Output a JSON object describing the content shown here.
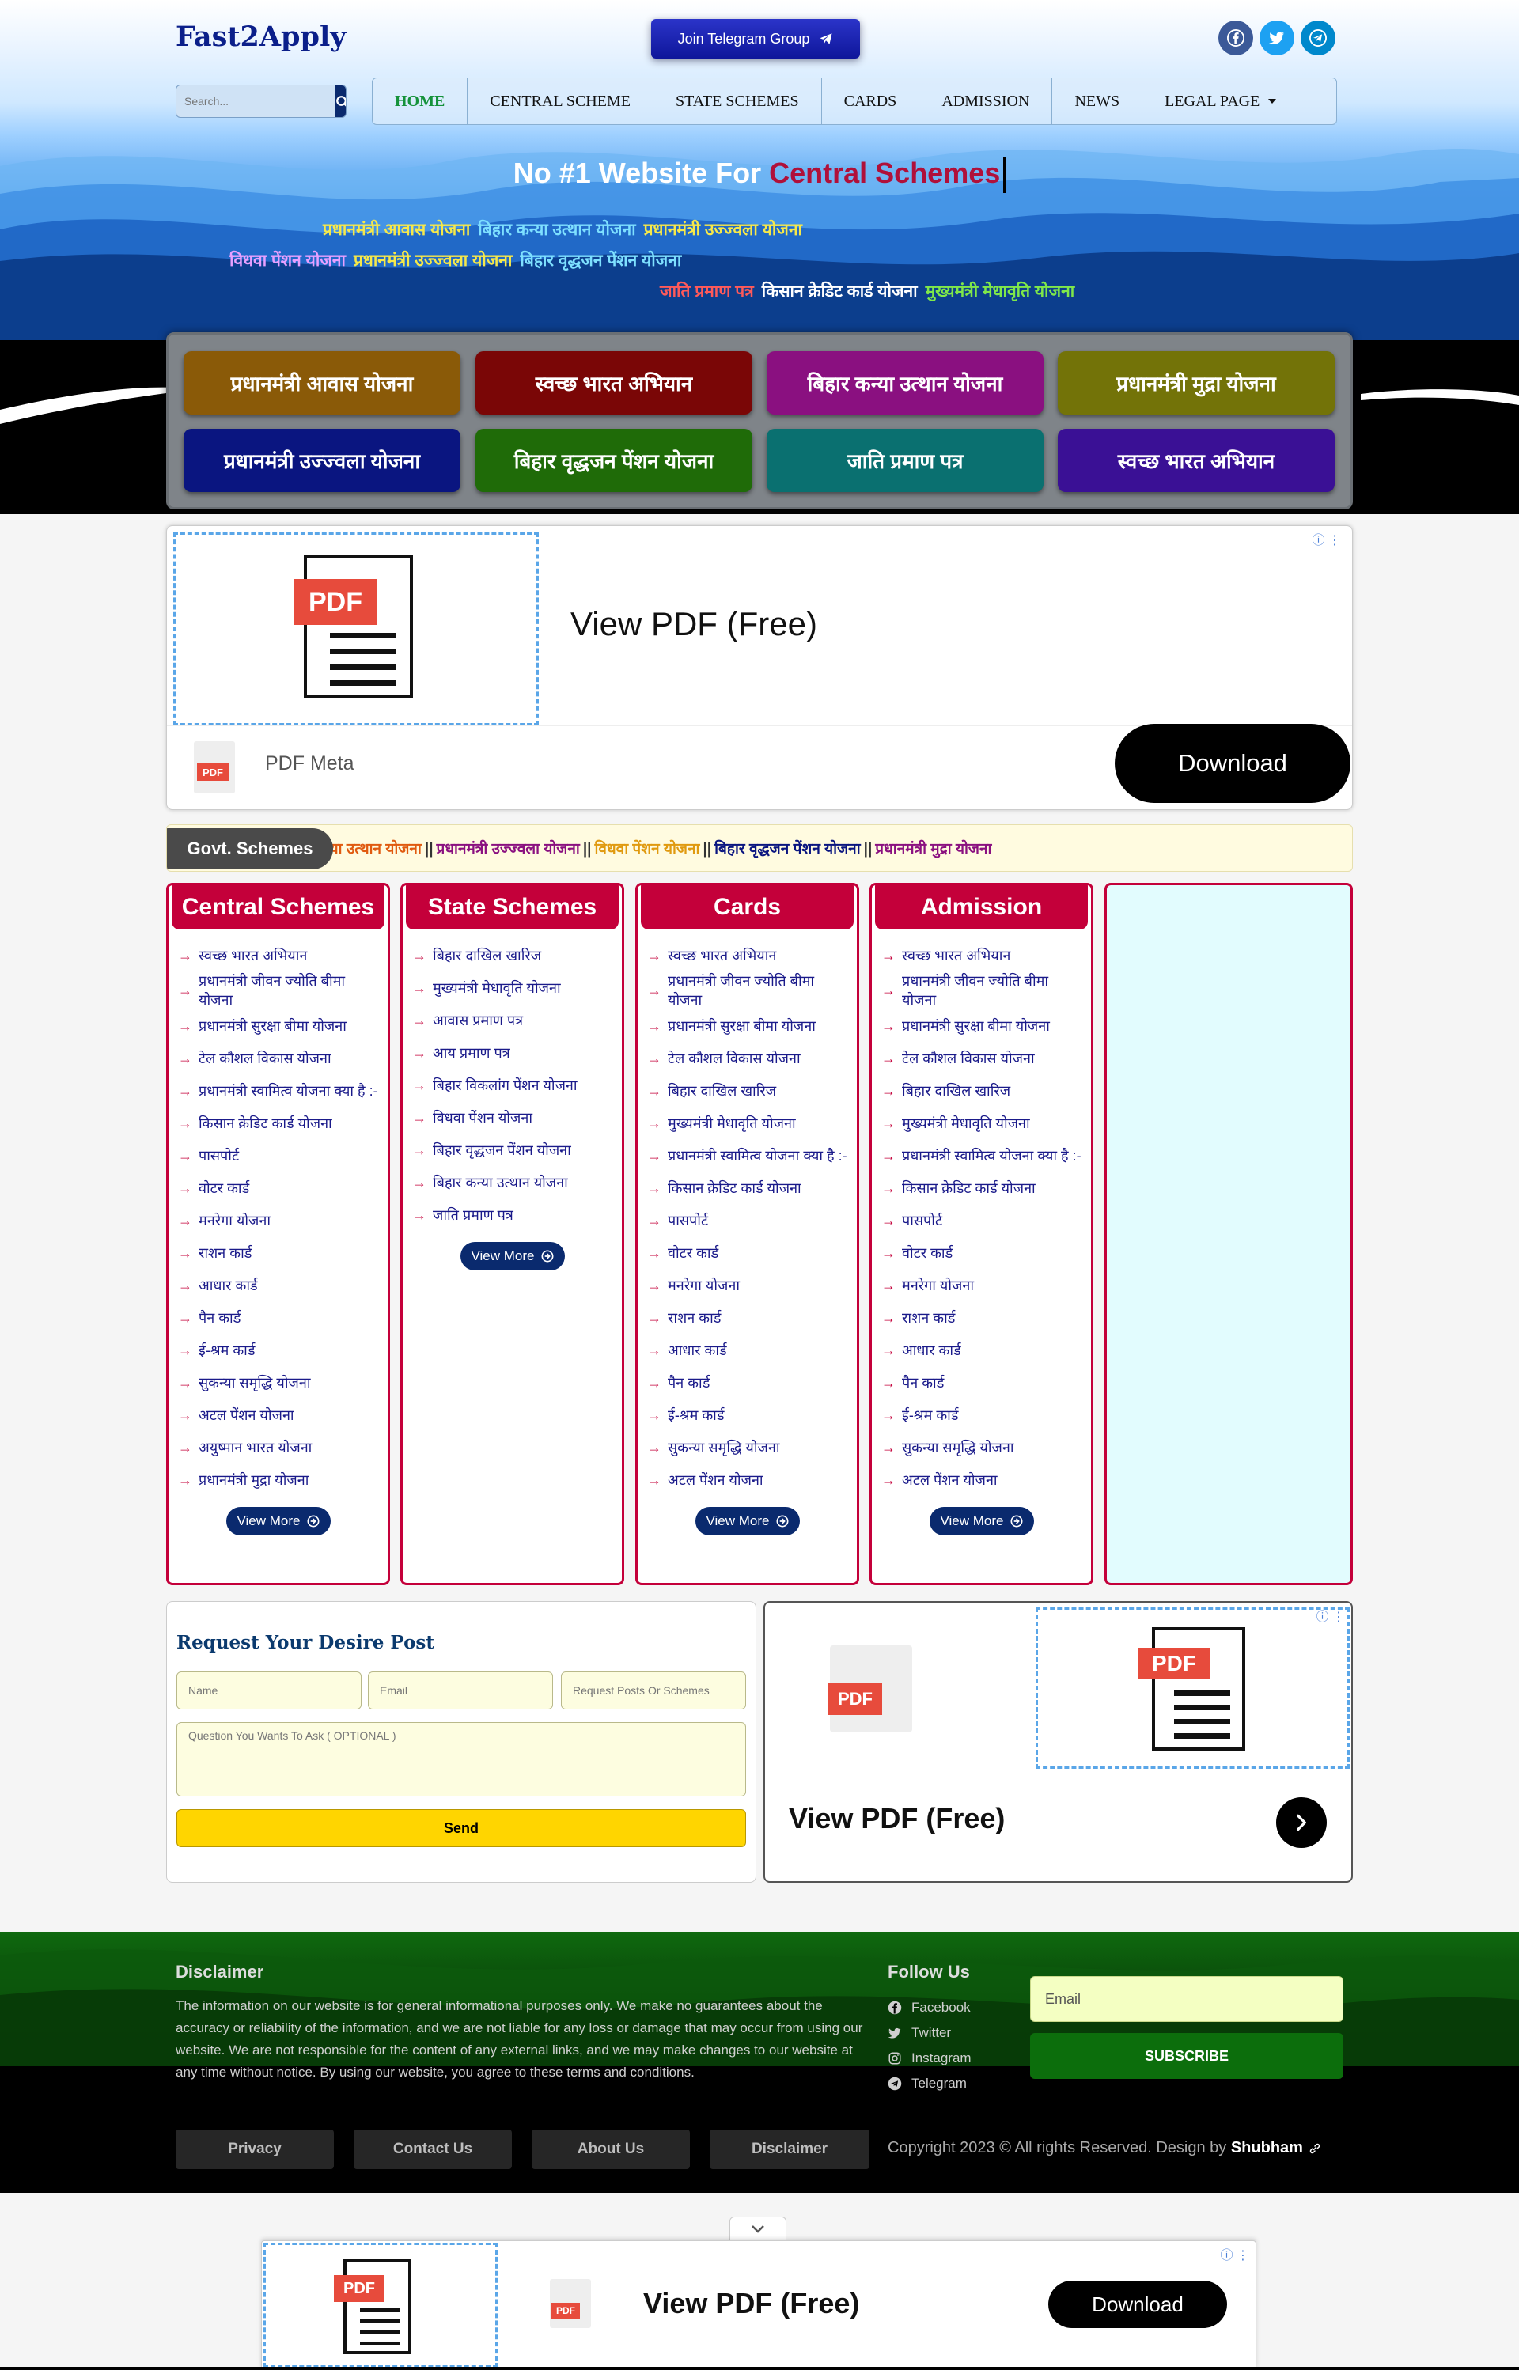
{
  "header": {
    "logo": "Fast2Apply",
    "telegram_button": "Join Telegram Group",
    "social": [
      {
        "name": "facebook",
        "icon": "facebook-icon",
        "color": "#3b5998"
      },
      {
        "name": "twitter",
        "icon": "twitter-icon",
        "color": "#1da1f2"
      },
      {
        "name": "telegram",
        "icon": "telegram-icon",
        "color": "#0088cc"
      }
    ],
    "search_placeholder": "Search...",
    "nav": [
      "HOME",
      "CENTRAL SCHEME",
      "STATE SCHEMES",
      "CARDS",
      "ADMISSION",
      "NEWS",
      "LEGAL PAGE"
    ],
    "active_nav": "HOME"
  },
  "hero": {
    "headline_prefix": "No #1 Website For ",
    "headline_highlight": "Central Schemes",
    "rows": [
      [
        {
          "t": "प्रधानमंत्री आवास योजना",
          "c": "#f6e84a"
        },
        {
          "t": "बिहार कन्या उत्थान योजना",
          "c": "#7ee0ff"
        },
        {
          "t": "प्रधानमंत्री उज्ज्वला योजना",
          "c": "#f6e84a"
        }
      ],
      [
        {
          "t": "विधवा पेंशन योजना",
          "c": "#e8a0ff"
        },
        {
          "t": "प्रधानमंत्री उज्ज्वला योजना",
          "c": "#f6e84a"
        },
        {
          "t": "बिहार वृद्धजन पेंशन योजना",
          "c": "#7ee0ff"
        }
      ],
      [
        {
          "t": "जाति प्रमाण पत्र",
          "c": "#ff5a5a"
        },
        {
          "t": "किसान क्रेडिट कार्ड योजना",
          "c": "#ffffff"
        },
        {
          "t": "मुख्यमंत्री मेधावृति योजना",
          "c": "#7fe84a"
        }
      ]
    ]
  },
  "scheme_buttons": [
    {
      "label": "प्रधानमंत्री आवास योजना",
      "color": "#8a5a08"
    },
    {
      "label": "स्वच्छ भारत अभियान",
      "color": "#7a0606"
    },
    {
      "label": "बिहार कन्या उत्थान योजना",
      "color": "#8a1080"
    },
    {
      "label": "प्रधानमंत्री मुद्रा योजना",
      "color": "#737308"
    },
    {
      "label": "प्रधानमंत्री उज्ज्वला योजना",
      "color": "#0a1580"
    },
    {
      "label": "बिहार वृद्धजन पेंशन योजना",
      "color": "#1f6b08"
    },
    {
      "label": "जाति प्रमाण पत्र",
      "color": "#0a7070"
    },
    {
      "label": "स्वच्छ भारत अभियान",
      "color": "#3a1095"
    }
  ],
  "ad_top": {
    "title": "View PDF (Free)",
    "brand": "PDF Meta",
    "cta": "Download",
    "pdf_label": "PDF"
  },
  "ticker": {
    "label": "Govt. Schemes",
    "items": [
      {
        "t": "न्या उत्थान योजना",
        "c": "#e05a10"
      },
      {
        "t": "प्रधानमंत्री उज्ज्वला योजना",
        "c": "#8a1080"
      },
      {
        "t": "विधवा पेंशन योजना",
        "c": "#e09a10"
      },
      {
        "t": "बिहार वृद्धजन पेंशन योजना",
        "c": "#0a1580"
      },
      {
        "t": "प्रधानमंत्री मुद्रा योजना",
        "c": "#8a1080"
      }
    ],
    "sep": "||"
  },
  "columns": [
    {
      "title": "Central Schemes",
      "items": [
        "स्वच्छ भारत अभियान",
        "प्रधानमंत्री जीवन ज्योति बीमा योजना",
        "प्रधानमंत्री सुरक्षा बीमा योजना",
        "टेल कौशल विकास योजना",
        "प्रधानमंत्री स्वामित्व योजना क्या है :-",
        "किसान क्रेडिट कार्ड योजना",
        "पासपोर्ट",
        "वोटर कार्ड",
        "मनरेगा योजना",
        "राशन कार्ड",
        "आधार कार्ड",
        "पैन कार्ड",
        "ई-श्रम कार्ड",
        "सुकन्या समृद्धि योजना",
        "अटल पेंशन योजना",
        "अयुष्मान भारत योजना",
        "प्रधानमंत्री मुद्रा योजना"
      ]
    },
    {
      "title": "State Schemes",
      "items": [
        "बिहार दाखिल खारिज",
        "मुख्यमंत्री मेधावृति योजना",
        "आवास प्रमाण पत्र",
        "आय प्रमाण पत्र",
        "बिहार विकलांग पेंशन योजना",
        "विधवा पेंशन योजना",
        "बिहार वृद्धजन पेंशन योजना",
        "बिहार कन्या उत्थान योजना",
        "जाति प्रमाण पत्र"
      ]
    },
    {
      "title": "Cards",
      "items": [
        "स्वच्छ भारत अभियान",
        "प्रधानमंत्री जीवन ज्योति बीमा योजना",
        "प्रधानमंत्री सुरक्षा बीमा योजना",
        "टेल कौशल विकास योजना",
        "बिहार दाखिल खारिज",
        "मुख्यमंत्री मेधावृति योजना",
        "प्रधानमंत्री स्वामित्व योजना क्या है :-",
        "किसान क्रेडिट कार्ड योजना",
        "पासपोर्ट",
        "वोटर कार्ड",
        "मनरेगा योजना",
        "राशन कार्ड",
        "आधार कार्ड",
        "पैन कार्ड",
        "ई-श्रम कार्ड",
        "सुकन्या समृद्धि योजना",
        "अटल पेंशन योजना"
      ]
    },
    {
      "title": "Admission",
      "items": [
        "स्वच्छ भारत अभियान",
        "प्रधानमंत्री जीवन ज्योति बीमा योजना",
        "प्रधानमंत्री सुरक्षा बीमा योजना",
        "टेल कौशल विकास योजना",
        "बिहार दाखिल खारिज",
        "मुख्यमंत्री मेधावृति योजना",
        "प्रधानमंत्री स्वामित्व योजना क्या है :-",
        "किसान क्रेडिट कार्ड योजना",
        "पासपोर्ट",
        "वोटर कार्ड",
        "मनरेगा योजना",
        "राशन कार्ड",
        "आधार कार्ड",
        "पैन कार्ड",
        "ई-श्रम कार्ड",
        "सुकन्या समृद्धि योजना",
        "अटल पेंशन योजना"
      ]
    }
  ],
  "view_more": "View More",
  "form": {
    "title": "Request Your Desire Post",
    "name_placeholder": "Name",
    "email_placeholder": "Email",
    "request_placeholder": "Request Posts Or Schemes",
    "question_placeholder": "Question You Wants To Ask ( OPTIONAL )",
    "send": "Send"
  },
  "ad_side": {
    "title": "View PDF (Free)",
    "pdf_label": "PDF"
  },
  "footer": {
    "disclaimer_title": "Disclaimer",
    "disclaimer_text": "The information on our website is for general informational purposes only. We make no guarantees about the accuracy or reliability of the information, and we are not liable for any loss or damage that may occur from using our website. We are not responsible for the content of any external links, and we may make changes to our website at any time without notice. By using our website, you agree to these terms and conditions.",
    "follow_title": "Follow Us",
    "follow_links": [
      {
        "label": "Facebook",
        "icon": "facebook-icon"
      },
      {
        "label": "Twitter",
        "icon": "twitter-icon"
      },
      {
        "label": "Instagram",
        "icon": "instagram-icon"
      },
      {
        "label": "Telegram",
        "icon": "telegram-icon"
      }
    ],
    "email_placeholder": "Email",
    "subscribe": "SUBSCRIBE",
    "links": [
      "Privacy",
      "Contact Us",
      "About Us",
      "Disclaimer"
    ],
    "copyright": "Copyright 2023 © All rights Reserved. Design by ",
    "designer": "Shubham"
  },
  "ad_sticky": {
    "title": "View PDF (Free)",
    "cta": "Download",
    "pdf_label": "PDF"
  }
}
